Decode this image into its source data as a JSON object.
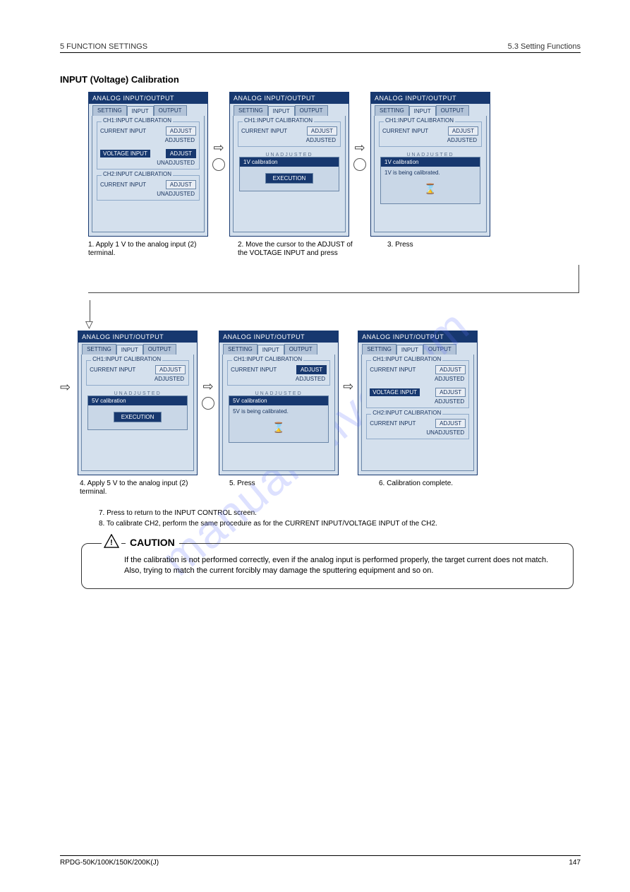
{
  "header": {
    "chapter": "5  FUNCTION SETTINGS",
    "section": "5.3  Setting Functions"
  },
  "section_title": "INPUT (Voltage) Calibration",
  "watermark": "manualshive.com",
  "screen_title": "ANALOG INPUT/OUTPUT",
  "tabs": {
    "setting": "SETTING",
    "input": "INPUT",
    "output": "OUTPUT"
  },
  "labels": {
    "ch1": "CH1:INPUT CALIBRATION",
    "ch2": "CH2:INPUT CALIBRATION",
    "current": "CURRENT INPUT",
    "voltage": "VOLTAGE INPUT",
    "adjust": "ADJUST",
    "adjusted": "ADJUSTED",
    "unadjusted": "UNADJUSTED",
    "execution": "EXECUTION",
    "cut": "UNADJUSTED"
  },
  "popups": {
    "cal1v": "1V calibration",
    "cal1v_msg": "1V is being calibrated.",
    "cal5v": "5V calibration",
    "cal5v_msg": "5V is being calibrated."
  },
  "flow": {
    "step1": "1. Apply 1 V to the analog input (2) terminal.",
    "step2": "2. Move the cursor to the ADJUST of the VOLTAGE INPUT and press",
    "step3": "3. Press",
    "step4": "4. Apply 5 V to the analog input (2) terminal.",
    "step5": "5. Press",
    "step6": "6. Calibration complete.",
    "step7": "7. Press          to return to the INPUT CONTROL screen.",
    "step8": "8. To calibrate CH2, perform the same procedure as for the CURRENT INPUT/VOLTAGE INPUT of the CH2."
  },
  "caution": {
    "title": "CAUTION",
    "text": "If the calibration is not performed correctly, even if the analog input is performed properly, the target current does not match. Also, trying to match the current forcibly may damage the sputtering equipment and so on."
  },
  "footer": {
    "model": "RPDG-50K/100K/150K/200K(J)",
    "page": "147"
  }
}
